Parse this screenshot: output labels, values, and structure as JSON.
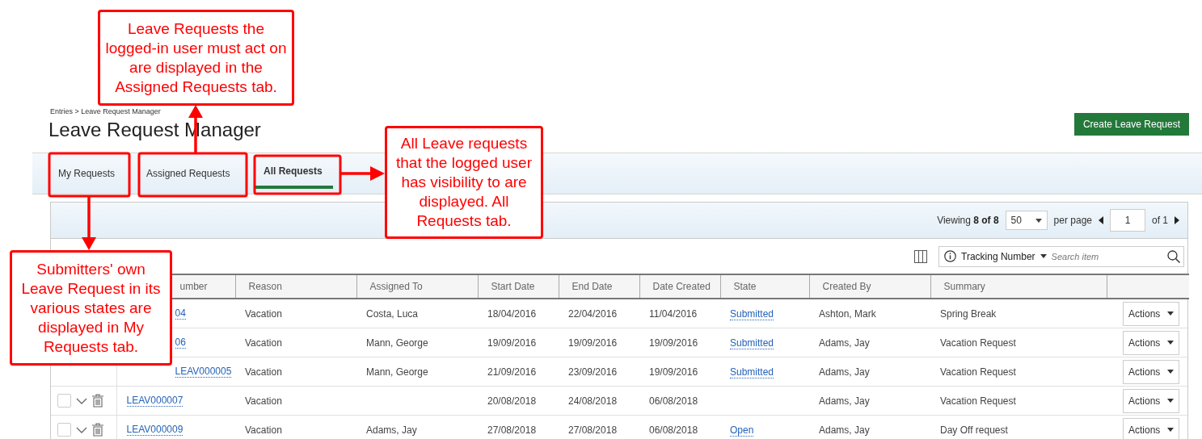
{
  "breadcrumb": "Entries > Leave Request Manager",
  "title": "Leave Request Manager",
  "create_button": "Create Leave Request",
  "tabs": [
    {
      "label": "My Requests",
      "selected": false
    },
    {
      "label": "Assigned Requests",
      "selected": false
    },
    {
      "label": "All Requests",
      "selected": true
    }
  ],
  "pagination": {
    "viewing": "Viewing **8 of 8**",
    "per_page_value": "50",
    "per_page_label": "per page",
    "page": "1",
    "of_pages": "of 1"
  },
  "search": {
    "field": "Tracking Number",
    "placeholder": "Search item"
  },
  "table": {
    "columns": [
      {
        "label": "umber",
        "covered": true
      },
      {
        "label": "Reason"
      },
      {
        "label": "Assigned To"
      },
      {
        "label": "Start Date"
      },
      {
        "label": "End Date"
      },
      {
        "label": "Date Created"
      },
      {
        "label": "State"
      },
      {
        "label": "Created By"
      },
      {
        "label": "Summary"
      },
      {}
    ],
    "rows": [
      {
        "covered": true,
        "tracking": "04",
        "reason": "Vacation",
        "assigned_to": "Costa, Luca",
        "start": "18/04/2016",
        "end": "22/04/2016",
        "created": "11/04/2016",
        "state": "Submitted",
        "created_by": "Ashton, Mark",
        "summary": "Spring Break",
        "action": "Actions"
      },
      {
        "covered": true,
        "tracking": "06",
        "reason": "Vacation",
        "assigned_to": "Mann, George",
        "start": "19/09/2016",
        "end": "19/09/2016",
        "created": "19/09/2016",
        "state": "Submitted",
        "created_by": "Adams, Jay",
        "summary": "Vacation Request",
        "action": "Actions"
      },
      {
        "covered": true,
        "tracking": "LEAV000005",
        "reason": "Vacation",
        "assigned_to": "Mann, George",
        "start": "21/09/2016",
        "end": "23/09/2016",
        "created": "19/09/2016",
        "state": "Submitted",
        "created_by": "Adams, Jay",
        "summary": "Vacation Request",
        "action": "Actions"
      },
      {
        "checked": false,
        "tracking": "LEAV000007",
        "reason": "Vacation",
        "start": "20/08/2018",
        "end": "24/08/2018",
        "created": "06/08/2018",
        "created_by": "Adams, Jay",
        "summary": "Vacation Request",
        "action": "Actions"
      },
      {
        "checked": false,
        "tracking": "LEAV000009",
        "reason": "Vacation",
        "assigned_to": "Adams, Jay",
        "start": "27/08/2018",
        "end": "27/08/2018",
        "created": "06/08/2018",
        "state": "Open",
        "created_by": "Adams, Jay",
        "summary": "Day Off request",
        "action": "Actions"
      }
    ]
  },
  "callouts": [
    {
      "kind": "assigned",
      "text": "Leave Requests the logged-in user must act on are displayed in the Assigned Requests tab."
    },
    {
      "kind": "all",
      "text": "All Leave requests that the logged user has visibility to are displayed. All Requests tab."
    },
    {
      "kind": "mine",
      "text": "Submitters' own Leave Request in its various states are displayed in My Requests tab."
    }
  ]
}
